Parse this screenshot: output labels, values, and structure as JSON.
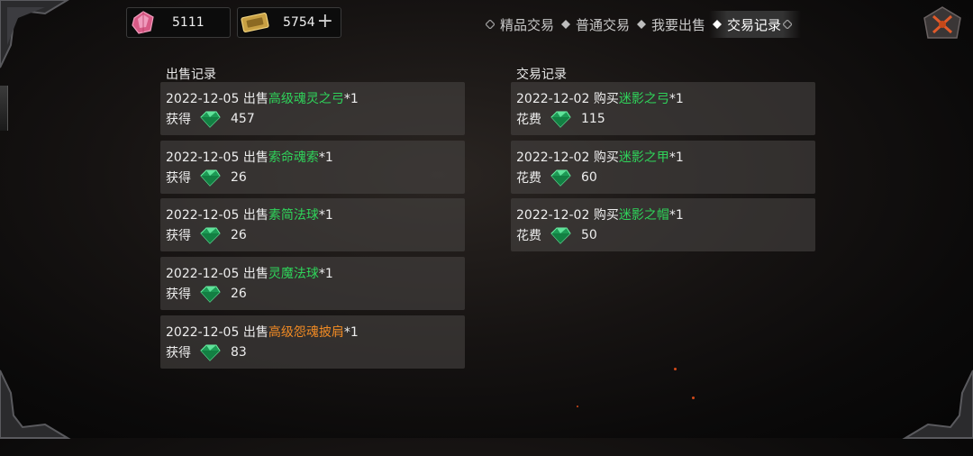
{
  "currency": {
    "gems": "5111",
    "tickets": "5754",
    "gem_icon": "pink-crystal-icon",
    "ticket_icon": "gold-ticket-icon",
    "add_label": "+"
  },
  "tabs": [
    {
      "label": "精品交易",
      "active": false
    },
    {
      "label": "普通交易",
      "active": false
    },
    {
      "label": "我要出售",
      "active": false
    },
    {
      "label": "交易记录",
      "active": true
    }
  ],
  "sell_panel": {
    "title": "出售记录",
    "records": [
      {
        "date": "2022-12-05",
        "action": "出售",
        "item": "高级魂灵之弓",
        "qty": "*1",
        "gain_label": "获得",
        "amount": "457",
        "rarity": "green"
      },
      {
        "date": "2022-12-05",
        "action": "出售",
        "item": "索命魂索",
        "qty": "*1",
        "gain_label": "获得",
        "amount": "26",
        "rarity": "green"
      },
      {
        "date": "2022-12-05",
        "action": "出售",
        "item": "素简法球",
        "qty": "*1",
        "gain_label": "获得",
        "amount": "26",
        "rarity": "green"
      },
      {
        "date": "2022-12-05",
        "action": "出售",
        "item": "灵魔法球",
        "qty": "*1",
        "gain_label": "获得",
        "amount": "26",
        "rarity": "green"
      },
      {
        "date": "2022-12-05",
        "action": "出售",
        "item": "高级怨魂披肩",
        "qty": "*1",
        "gain_label": "获得",
        "amount": "83",
        "rarity": "orange"
      }
    ]
  },
  "trade_panel": {
    "title": "交易记录",
    "records": [
      {
        "date": "2022-12-02",
        "action": "购买",
        "item": "迷影之弓",
        "qty": "*1",
        "gain_label": "花费",
        "amount": "115",
        "rarity": "green"
      },
      {
        "date": "2022-12-02",
        "action": "购买",
        "item": "迷影之甲",
        "qty": "*1",
        "gain_label": "花费",
        "amount": "60",
        "rarity": "green"
      },
      {
        "date": "2022-12-02",
        "action": "购买",
        "item": "迷影之帽",
        "qty": "*1",
        "gain_label": "花费",
        "amount": "50",
        "rarity": "green"
      }
    ]
  },
  "colors": {
    "green_item": "#2fd35a",
    "orange_item": "#f08a24",
    "card_bg": "#464240"
  },
  "icons": {
    "green_gem": "green-gem-icon",
    "settings": "crossed-swords-settings-icon"
  }
}
